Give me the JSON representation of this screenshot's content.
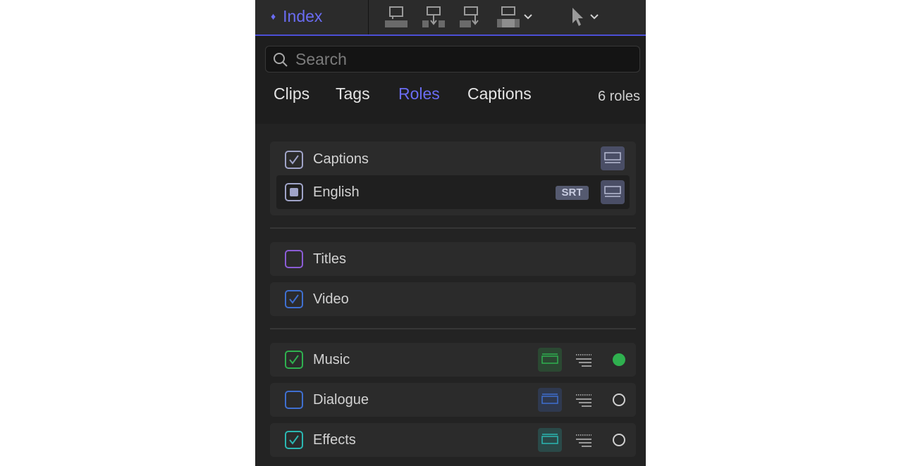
{
  "toolbar": {
    "index_label": "Index",
    "icons": [
      "append-clip-icon",
      "insert-clip-icon",
      "overwrite-clip-icon",
      "connect-clip-icon",
      "select-tool-icon"
    ],
    "accent": "#6a6cf2"
  },
  "search": {
    "placeholder": "Search",
    "value": ""
  },
  "tabs": [
    {
      "label": "Clips",
      "active": false
    },
    {
      "label": "Tags",
      "active": false
    },
    {
      "label": "Roles",
      "active": true
    },
    {
      "label": "Captions",
      "active": false
    }
  ],
  "role_count": "6 roles",
  "caption_group": {
    "label": "Captions",
    "checked": true,
    "color": "#a0a4c8",
    "subroles": [
      {
        "label": "English",
        "badge": "SRT",
        "state": "partial",
        "color": "#a0a4c8"
      }
    ]
  },
  "video_roles": [
    {
      "label": "Titles",
      "checked": false,
      "color": "#8b5cd6"
    },
    {
      "label": "Video",
      "checked": true,
      "color": "#3f6fd0"
    }
  ],
  "audio_roles": [
    {
      "label": "Music",
      "checked": true,
      "color": "#2fb04f",
      "active_dot": true
    },
    {
      "label": "Dialogue",
      "checked": false,
      "color": "#3f6fd0",
      "active_dot": false
    },
    {
      "label": "Effects",
      "checked": true,
      "color": "#2bb7b2",
      "active_dot": false
    }
  ]
}
